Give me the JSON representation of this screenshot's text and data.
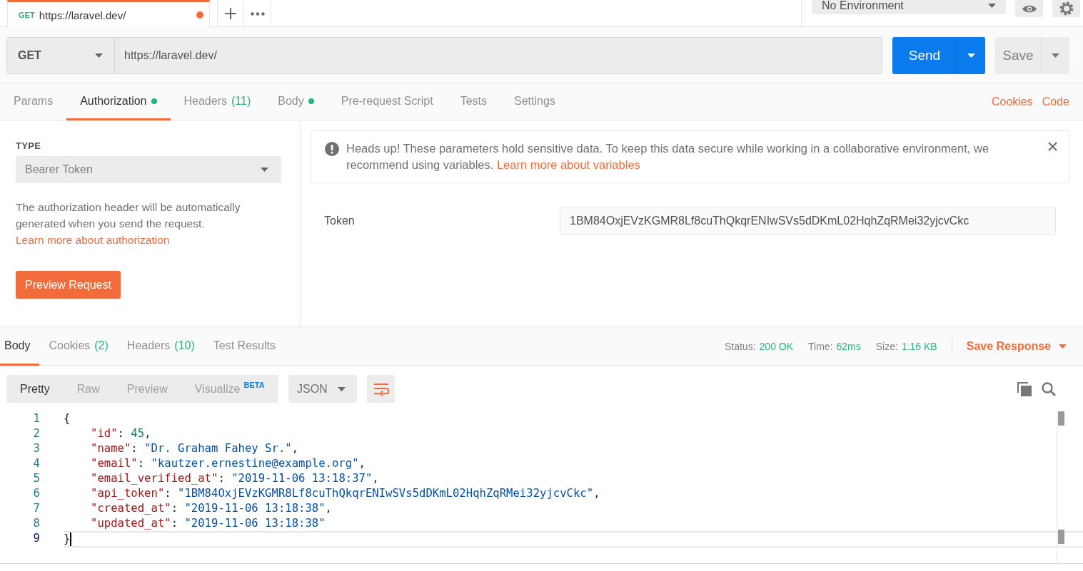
{
  "request_tab": {
    "method": "GET",
    "title": "https://laravel.dev/",
    "unsaved": true
  },
  "environment": {
    "value": "No Environment"
  },
  "request": {
    "method": "GET",
    "url": "https://laravel.dev/",
    "send": "Send",
    "save": "Save"
  },
  "request_tabs": [
    {
      "label": "Params",
      "selected": false,
      "dot": false
    },
    {
      "label": "Authorization",
      "selected": true,
      "dot": true
    },
    {
      "label": "Headers",
      "count": "(11)",
      "selected": false,
      "dot": false
    },
    {
      "label": "Body",
      "selected": false,
      "dot": true
    },
    {
      "label": "Pre-request Script",
      "selected": false,
      "dot": false
    },
    {
      "label": "Tests",
      "selected": false,
      "dot": false
    },
    {
      "label": "Settings",
      "selected": false,
      "dot": false
    }
  ],
  "request_links": [
    "Cookies",
    "Code"
  ],
  "auth": {
    "type_label": "TYPE",
    "type": "Bearer Token",
    "description": "The authorization header will be automatically generated when you send the request. ",
    "link": "Learn more about authorization",
    "preview_button": "Preview Request"
  },
  "notice": {
    "text": "Heads up! These parameters hold sensitive data. To keep this data secure while working in a collaborative environment, we recommend using variables. ",
    "link": "Learn more about variables"
  },
  "token": {
    "label": "Token",
    "value": "1BM84OxjEVzKGMR8Lf8cuThQkqrENIwSVs5dDKmL02HqhZqRMei32yjcvCkc"
  },
  "response_tabs": [
    {
      "label": "Body",
      "selected": true
    },
    {
      "label": "Cookies",
      "count": "(2)",
      "selected": false
    },
    {
      "label": "Headers",
      "count": "(10)",
      "selected": false
    },
    {
      "label": "Test Results",
      "selected": false
    }
  ],
  "response_stats": [
    {
      "label": "Status:",
      "value": "200 OK"
    },
    {
      "label": "Time:",
      "value": "62ms"
    },
    {
      "label": "Size:",
      "value": "1.16 KB"
    }
  ],
  "save_response": "Save Response",
  "view_modes": [
    {
      "label": "Pretty",
      "selected": true
    },
    {
      "label": "Raw",
      "selected": false
    },
    {
      "label": "Preview",
      "selected": false
    },
    {
      "label": "Visualize",
      "badge": "BETA",
      "selected": false
    }
  ],
  "format": "JSON",
  "code": [
    {
      "number": "1",
      "selected": false,
      "parts": [
        {
          "kind": "punct",
          "text": "{"
        }
      ],
      "children": [
        {
          "number": "2",
          "selected": false,
          "parts": [
            {
              "kind": "key",
              "text": "\"id\""
            },
            {
              "kind": "punct",
              "text": ": "
            },
            {
              "kind": "number",
              "text": "45"
            },
            {
              "kind": "punct",
              "text": ","
            }
          ]
        },
        {
          "number": "3",
          "selected": false,
          "parts": [
            {
              "kind": "key",
              "text": "\"name\""
            },
            {
              "kind": "punct",
              "text": ": "
            },
            {
              "kind": "string",
              "text": "\"Dr. Graham Fahey Sr.\""
            },
            {
              "kind": "punct",
              "text": ","
            }
          ]
        },
        {
          "number": "4",
          "selected": false,
          "parts": [
            {
              "kind": "key",
              "text": "\"email\""
            },
            {
              "kind": "punct",
              "text": ": "
            },
            {
              "kind": "string",
              "text": "\"kautzer.ernestine@example.org\""
            },
            {
              "kind": "punct",
              "text": ","
            }
          ]
        },
        {
          "number": "5",
          "selected": false,
          "parts": [
            {
              "kind": "key",
              "text": "\"email_verified_at\""
            },
            {
              "kind": "punct",
              "text": ": "
            },
            {
              "kind": "string",
              "text": "\"2019-11-06 13:18:37\""
            },
            {
              "kind": "punct",
              "text": ","
            }
          ]
        },
        {
          "number": "6",
          "selected": false,
          "parts": [
            {
              "kind": "key",
              "text": "\"api_token\""
            },
            {
              "kind": "punct",
              "text": ": "
            },
            {
              "kind": "string",
              "text": "\"1BM84OxjEVzKGMR8Lf8cuThQkqrENIwSVs5dDKmL02HqhZqRMei32yjcvCkc\""
            },
            {
              "kind": "punct",
              "text": ","
            }
          ]
        },
        {
          "number": "7",
          "selected": false,
          "parts": [
            {
              "kind": "key",
              "text": "\"created_at\""
            },
            {
              "kind": "punct",
              "text": ": "
            },
            {
              "kind": "string",
              "text": "\"2019-11-06 13:18:38\""
            },
            {
              "kind": "punct",
              "text": ","
            }
          ]
        },
        {
          "number": "8",
          "selected": false,
          "parts": [
            {
              "kind": "key",
              "text": "\"updated_at\""
            },
            {
              "kind": "punct",
              "text": ": "
            },
            {
              "kind": "string",
              "text": "\"2019-11-06 13:18:38\""
            }
          ]
        }
      ]
    },
    {
      "number": "9",
      "selected": true,
      "parts": [
        {
          "kind": "punct",
          "text": "}"
        }
      ]
    }
  ]
}
